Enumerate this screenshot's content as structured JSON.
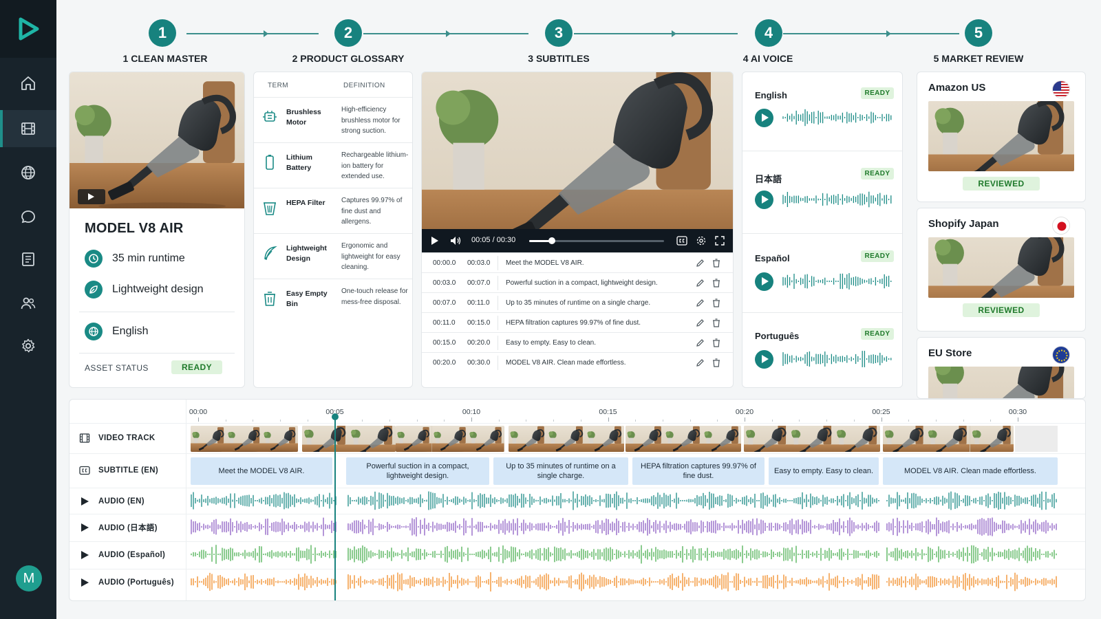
{
  "steps": [
    {
      "num": "1",
      "label": "1  CLEAN MASTER"
    },
    {
      "num": "2",
      "label": "2  PRODUCT GLOSSARY"
    },
    {
      "num": "3",
      "label": "3  SUBTITLES"
    },
    {
      "num": "4",
      "label": "4  AI VOICE"
    },
    {
      "num": "5",
      "label": "5  MARKET REVIEW"
    }
  ],
  "master": {
    "title": "MODEL V8 AIR",
    "features": [
      "35 min runtime",
      "Lightweight design"
    ],
    "language": "English",
    "asset_status_label": "ASSET STATUS",
    "asset_status": "READY"
  },
  "glossary": {
    "col_term": "TERM",
    "col_definition": "DEFINITION",
    "rows": [
      {
        "term": "Brushless Motor",
        "definition": "High-efficiency brushless motor for strong suction.",
        "icon": "motor-icon"
      },
      {
        "term": "Lithium Battery",
        "definition": "Rechargeable lithium-ion battery for extended use.",
        "icon": "battery-icon"
      },
      {
        "term": "HEPA Filter",
        "definition": "Captures 99.97% of fine dust and allergens.",
        "icon": "filter-icon"
      },
      {
        "term": "Lightweight Design",
        "definition": "Ergonomic and lightweight for easy cleaning.",
        "icon": "feather-icon"
      },
      {
        "term": "Easy Empty Bin",
        "definition": "One-touch release for mess-free disposal.",
        "icon": "bin-icon"
      }
    ]
  },
  "player": {
    "time": "00:05 / 00:30",
    "progress": 0.17
  },
  "subtitles": [
    {
      "start": "00:00.0",
      "end": "00:03.0",
      "text": "Meet the MODEL V8 AIR."
    },
    {
      "start": "00:03.0",
      "end": "00:07.0",
      "text": "Powerful suction in a compact, lightweight design."
    },
    {
      "start": "00:07.0",
      "end": "00:11.0",
      "text": "Up to 35 minutes of runtime on a single charge."
    },
    {
      "start": "00:11.0",
      "end": "00:15.0",
      "text": "HEPA filtration captures 99.97% of fine dust."
    },
    {
      "start": "00:15.0",
      "end": "00:20.0",
      "text": "Easy to empty. Easy to clean."
    },
    {
      "start": "00:20.0",
      "end": "00:30.0",
      "text": "MODEL V8 AIR. Clean made effortless."
    }
  ],
  "voices": [
    {
      "lang": "English",
      "status": "READY"
    },
    {
      "lang": "日本語",
      "status": "READY"
    },
    {
      "lang": "Español",
      "status": "READY"
    },
    {
      "lang": "Português",
      "status": "READY"
    }
  ],
  "markets": [
    {
      "name": "Amazon US",
      "status": "REVIEWED",
      "flag": "us-flag-icon"
    },
    {
      "name": "Shopify Japan",
      "status": "REVIEWED",
      "flag": "japan-flag-icon"
    },
    {
      "name": "EU Store",
      "status": "",
      "flag": "eu-flag-icon"
    }
  ],
  "timeline": {
    "ticks": [
      "00:00",
      "00:05",
      "00:10",
      "00:15",
      "00:20",
      "00:25",
      "00:30"
    ],
    "tracks": [
      "VIDEO TRACK",
      "SUBTITLE (EN)",
      "AUDIO (EN)",
      "AUDIO (日本語)",
      "AUDIO (Español)",
      "AUDIO (Português)"
    ],
    "subtitle_clips": [
      "Meet the MODEL V8 AIR.",
      "Powerful suction in a compact, lightweight design.",
      "Up to 35 minutes of runtime on a single charge.",
      "HEPA filtration captures 99.97% of fine dust.",
      "Easy to empty. Easy to clean.",
      "MODEL V8 AIR. Clean made effortless."
    ],
    "audio_colors": [
      "#1a8a85",
      "#8b5cc4",
      "#4caf50",
      "#f08a24"
    ],
    "playhead_time": "00:05"
  },
  "colors": {
    "accent": "#17827e",
    "sidebar": "#18232b",
    "ready_bg": "#dff3dd",
    "ready_text": "#1f7a2b"
  }
}
